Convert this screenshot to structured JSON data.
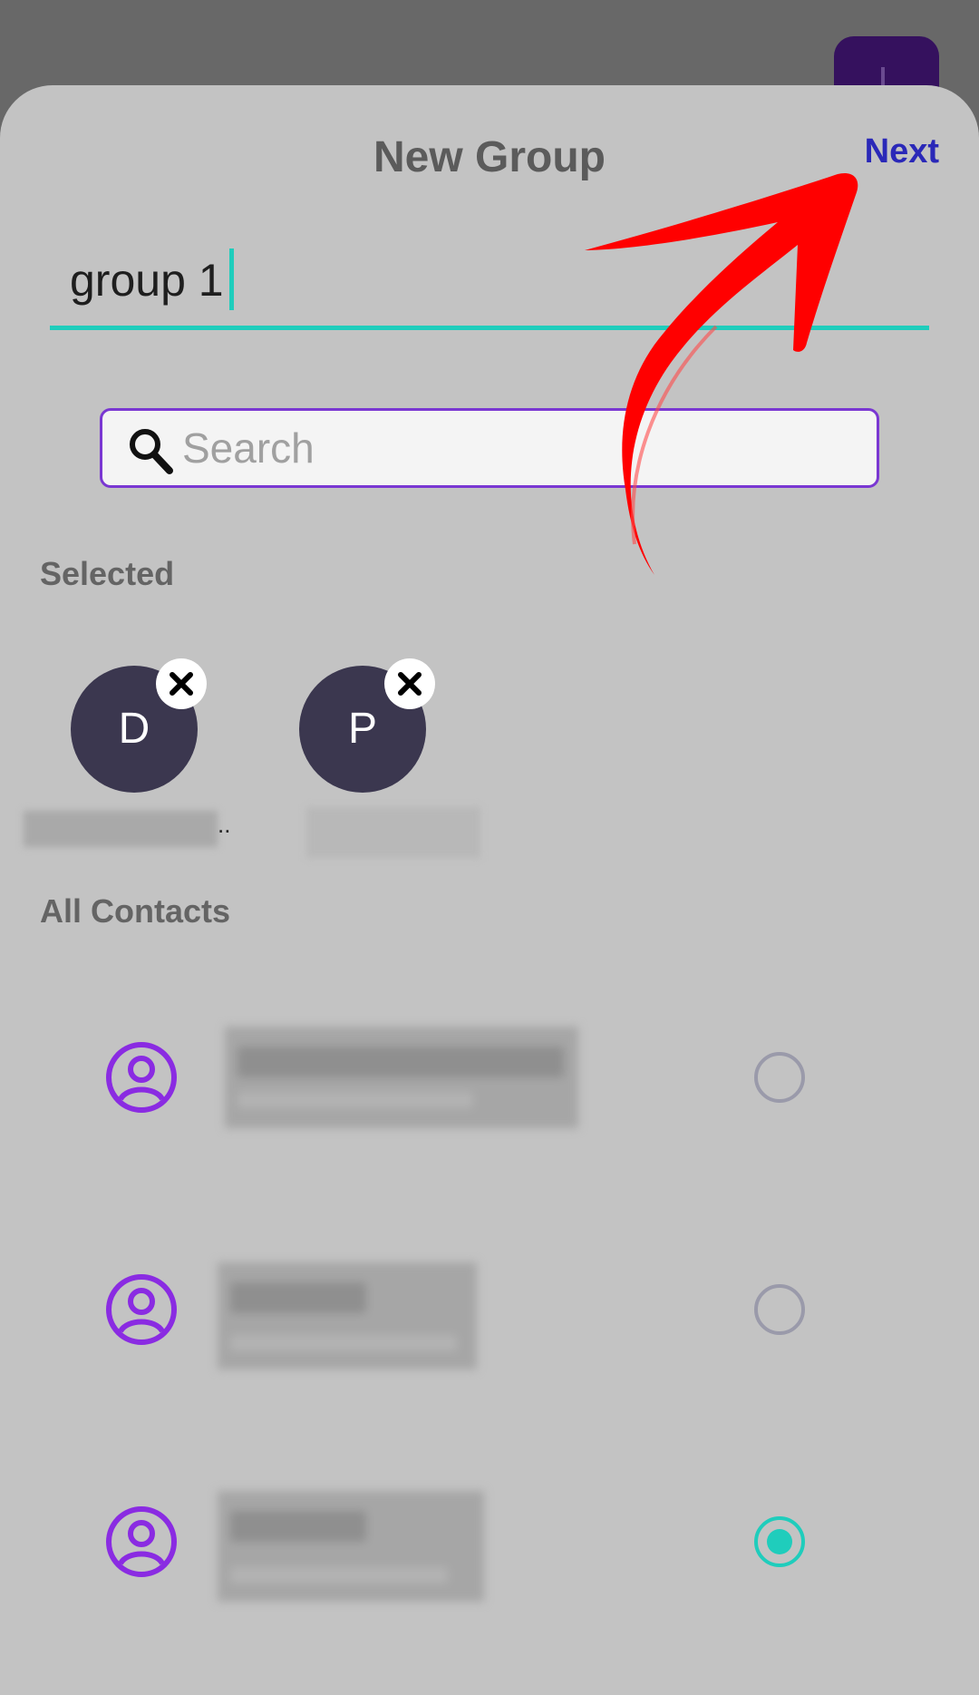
{
  "header": {
    "title": "New Group",
    "next_label": "Next"
  },
  "group_name": {
    "value": "group 1"
  },
  "search": {
    "placeholder": "Search"
  },
  "selected": {
    "label": "Selected",
    "chips": [
      {
        "initial": "D",
        "trailing": ".."
      },
      {
        "initial": "P"
      }
    ]
  },
  "contacts": {
    "label": "All Contacts",
    "items": [
      {
        "selected": false
      },
      {
        "selected": false
      },
      {
        "selected": true
      }
    ]
  },
  "colors": {
    "accent_teal": "#1fcdbc",
    "accent_purple": "#7a37d2",
    "next_link": "#2a28b8",
    "avatar_bg": "#3b374f",
    "annotation_arrow": "#ff0000"
  }
}
